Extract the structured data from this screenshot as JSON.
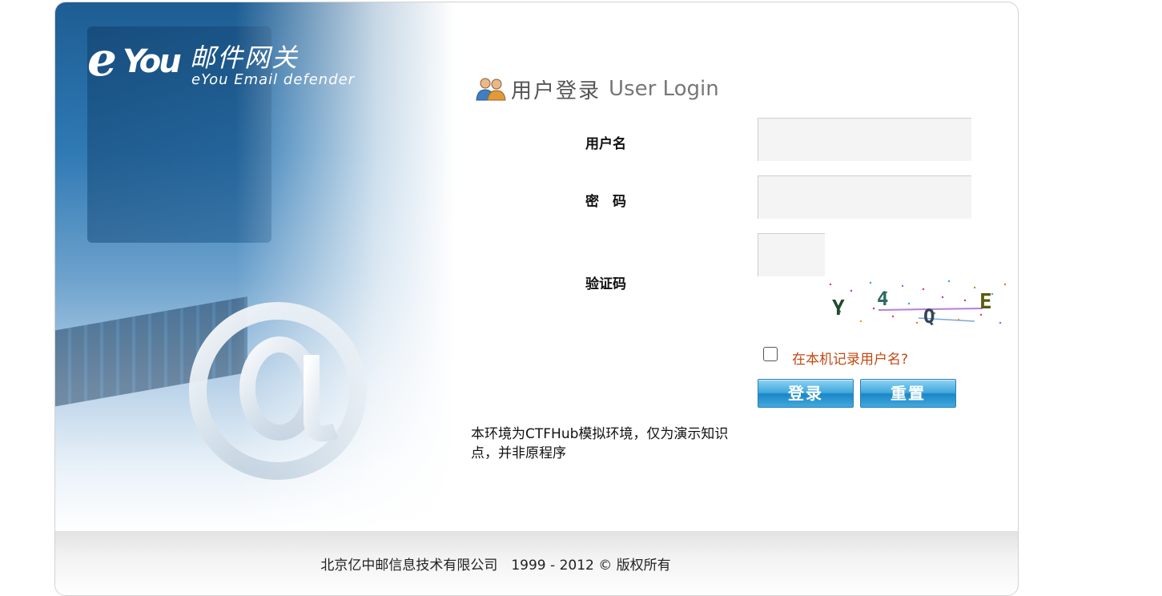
{
  "brand": {
    "logo_e": "e",
    "logo_you": "You",
    "name_cn": "邮件网关",
    "name_en": "eYou Email defender"
  },
  "login": {
    "title_cn": "用户登录",
    "title_en": "User Login",
    "username_label": "用户名",
    "username_value": "",
    "password_label": "密　码",
    "password_value": "",
    "captcha_label": "验证码",
    "captcha_value": "",
    "captcha_text": "Y4QE",
    "remember_label": "在本机记录用户名?",
    "remember_checked": false,
    "login_button": "登录",
    "reset_button": "重置"
  },
  "notice": "本环境为CTFHub模拟环境，仅为演示知识点，并非原程序",
  "footer": {
    "copyright": "北京亿中邮信息技术有限公司　1999 - 2012 © 版权所有"
  },
  "colors": {
    "button_blue": "#2b95d3",
    "remember_text": "#c24a12",
    "hero_blue": "#2f79b4"
  },
  "icons": [
    "users-icon",
    "at-sign-icon",
    "checkbox"
  ]
}
